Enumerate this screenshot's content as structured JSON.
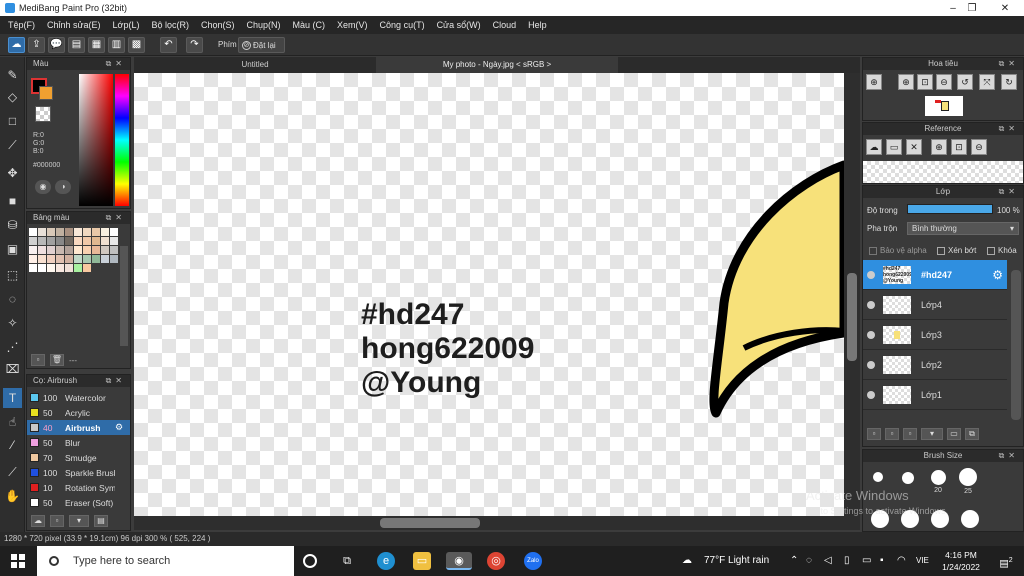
{
  "window": {
    "title": "MediBang Paint Pro (32bit)",
    "controls": {
      "minimize": "–",
      "maximize": "❐",
      "close": "✕"
    }
  },
  "menu": [
    "Tệp(F)",
    "Chỉnh sửa(E)",
    "Lớp(L)",
    "Bộ lọc(R)",
    "Chọn(S)",
    "Chụp(N)",
    "Màu (C)",
    "Xem(V)",
    "Công cụ(T)",
    "Cửa sổ(W)",
    "Cloud",
    "Help"
  ],
  "toolbar": {
    "shortcut_label": "Phím",
    "reset_label": "Đặt lại"
  },
  "color_panel": {
    "title": "Màu",
    "r": "R:0",
    "g": "G:0",
    "b": "B:0",
    "hex": "#000000",
    "fg_color": "#000000",
    "bg_color": "#f0a030"
  },
  "palette_panel": {
    "title": "Bảng màu",
    "footer_text": "---"
  },
  "brush_panel": {
    "title": "Cọ: Airbrush",
    "items": [
      {
        "size": "100",
        "name": "Watercolor",
        "color": "#5bc8f0"
      },
      {
        "size": "50",
        "name": "Acrylic",
        "color": "#e8e020"
      },
      {
        "size": "40",
        "name": "Airbrush",
        "color": "#c8c8c8"
      },
      {
        "size": "50",
        "name": "Blur",
        "color": "#f0a0e0"
      },
      {
        "size": "70",
        "name": "Smudge",
        "color": "#f0c8a0"
      },
      {
        "size": "100",
        "name": "Sparkle Brush",
        "color": "#2050e0"
      },
      {
        "size": "10",
        "name": "Rotation Symmetry",
        "color": "#e02020"
      },
      {
        "size": "50",
        "name": "Eraser (Soft)",
        "color": "#ffffff"
      }
    ]
  },
  "document": {
    "tabs": [
      "Untitled",
      "My photo - Ngày.jpg < sRGB >"
    ],
    "canvas_lines": [
      "#hd247",
      "hong622009",
      "@Young"
    ]
  },
  "navigator_panel": {
    "title": "Hoa tiêu"
  },
  "reference_panel": {
    "title": "Reference"
  },
  "layer_panel": {
    "title": "Lớp",
    "opacity_label": "Độ trong",
    "opacity_value": "100 %",
    "opacity_fraction": 1.0,
    "blend_label": "Pha trộn",
    "blend_value": "Bình thường",
    "protect_alpha": "Bảo vệ alpha",
    "clipping": "Xén bớt",
    "lock": "Khóa",
    "layers": [
      {
        "name": "#hd247",
        "thumb_text": "#hd247 hong622009 @Young"
      },
      {
        "name": "Lớp4",
        "thumb_text": ""
      },
      {
        "name": "Lớp3",
        "thumb_text": ""
      },
      {
        "name": "Lớp2",
        "thumb_text": ""
      },
      {
        "name": "Lớp1",
        "thumb_text": ""
      }
    ]
  },
  "brush_size_panel": {
    "title": "Brush Size",
    "sizes": [
      "",
      "",
      "20",
      "25"
    ]
  },
  "status": {
    "text": "1280 * 720 pixel   (33.9 * 19.1cm)   96 dpi   300 %   ( 525, 224 )"
  },
  "watermark": {
    "line1": "Activate Windows",
    "line2": "Go to Settings to activate Windows."
  },
  "taskbar": {
    "search_placeholder": "Type here to search",
    "weather": "77°F  Light rain",
    "lang": "VIE",
    "time": "4:16 PM",
    "date": "1/24/2022",
    "notif_count": "2"
  }
}
